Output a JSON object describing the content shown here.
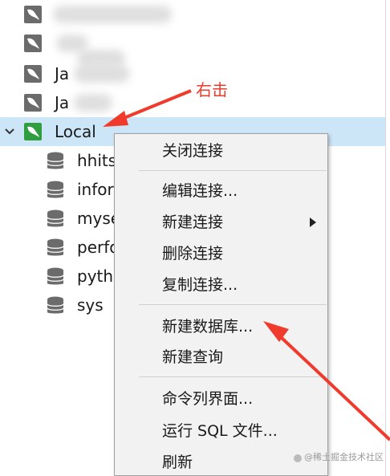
{
  "tree": {
    "connections": [
      {
        "label": "",
        "icon": "mysql-connection-icon",
        "blurred": true
      },
      {
        "label": "",
        "icon": "mysql-connection-icon",
        "blurred": true
      },
      {
        "label": "Ja",
        "icon": "mysql-connection-icon",
        "blurred": true
      },
      {
        "label": "Ja",
        "icon": "mysql-connection-icon",
        "blurred": true
      },
      {
        "label": "Local",
        "icon": "mysql-connection-icon-active",
        "expanded": true,
        "selected": true
      }
    ],
    "databases": [
      {
        "label": "hhits",
        "icon": "database-icon"
      },
      {
        "label": "infor",
        "icon": "database-icon"
      },
      {
        "label": "myse",
        "icon": "database-icon"
      },
      {
        "label": "perfo",
        "icon": "database-icon"
      },
      {
        "label": "pyth",
        "icon": "database-icon"
      },
      {
        "label": "sys",
        "icon": "database-icon"
      }
    ]
  },
  "annotation": {
    "right_click_note": "右击",
    "color": "#f03a2c"
  },
  "context_menu": {
    "items": [
      {
        "label": "关闭连接"
      },
      {
        "label": "编辑连接..."
      },
      {
        "label": "新建连接",
        "has_submenu": true
      },
      {
        "label": "删除连接"
      },
      {
        "label": "复制连接..."
      },
      {
        "label": "新建数据库..."
      },
      {
        "label": "新建查询"
      },
      {
        "label": "命令列界面..."
      },
      {
        "label": "运行 SQL 文件..."
      },
      {
        "label": "刷新"
      }
    ]
  },
  "watermark": "@稀土掘金技术社区",
  "colors": {
    "selection": "#cce6f8",
    "mysql_icon_gray": "#6b6b6b",
    "mysql_icon_green": "#2e9e3e"
  }
}
